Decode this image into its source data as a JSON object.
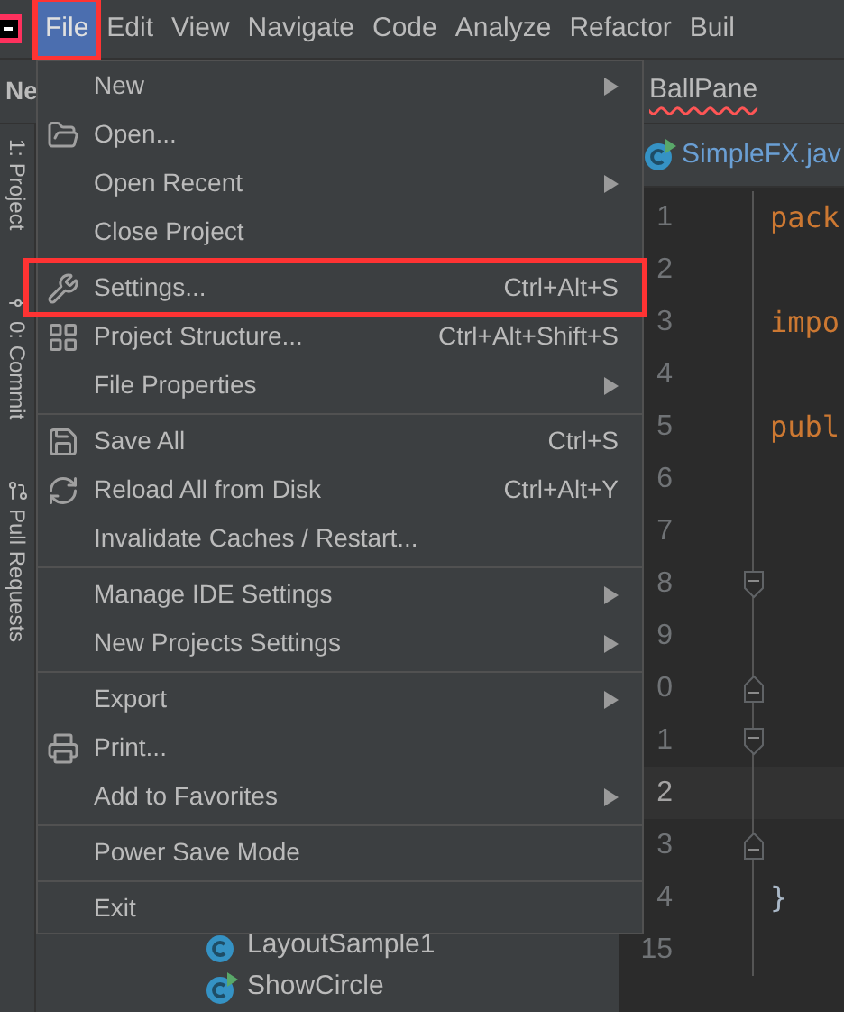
{
  "menubar": [
    {
      "label": "File",
      "selected": true,
      "highlighted": true
    },
    {
      "label": "Edit",
      "selected": false,
      "highlighted": false
    },
    {
      "label": "View",
      "selected": false,
      "highlighted": false
    },
    {
      "label": "Navigate",
      "selected": false,
      "highlighted": false
    },
    {
      "label": "Code",
      "selected": false,
      "highlighted": false
    },
    {
      "label": "Analyze",
      "selected": false,
      "highlighted": false
    },
    {
      "label": "Refactor",
      "selected": false,
      "highlighted": false
    },
    {
      "label": "Buil",
      "selected": false,
      "highlighted": false
    }
  ],
  "file_menu": [
    {
      "kind": "item",
      "label": "New",
      "submenu": true,
      "highlighted": false
    },
    {
      "kind": "item",
      "label": "Open...",
      "submenu": false,
      "highlighted": false
    },
    {
      "kind": "item",
      "label": "Open Recent",
      "submenu": true,
      "highlighted": false
    },
    {
      "kind": "item",
      "label": "Close Project",
      "submenu": false,
      "highlighted": false
    },
    {
      "kind": "separator"
    },
    {
      "kind": "item",
      "label": "Settings...",
      "shortcut": "Ctrl+Alt+S",
      "submenu": false,
      "highlighted": true
    },
    {
      "kind": "item",
      "label": "Project Structure...",
      "shortcut": "Ctrl+Alt+Shift+S",
      "submenu": false,
      "highlighted": false
    },
    {
      "kind": "item",
      "label": "File Properties",
      "submenu": true,
      "highlighted": false
    },
    {
      "kind": "separator"
    },
    {
      "kind": "item",
      "label": "Save All",
      "shortcut": "Ctrl+S",
      "submenu": false,
      "highlighted": false
    },
    {
      "kind": "item",
      "label": "Reload All from Disk",
      "shortcut": "Ctrl+Alt+Y",
      "submenu": false,
      "highlighted": false
    },
    {
      "kind": "item",
      "label": "Invalidate Caches / Restart...",
      "submenu": false,
      "highlighted": false
    },
    {
      "kind": "separator"
    },
    {
      "kind": "item",
      "label": "Manage IDE Settings",
      "submenu": true,
      "highlighted": false
    },
    {
      "kind": "item",
      "label": "New Projects Settings",
      "submenu": true,
      "highlighted": false
    },
    {
      "kind": "separator"
    },
    {
      "kind": "item",
      "label": "Export",
      "submenu": true,
      "highlighted": false
    },
    {
      "kind": "item",
      "label": "Print...",
      "submenu": false,
      "highlighted": false
    },
    {
      "kind": "item",
      "label": "Add to Favorites",
      "submenu": true,
      "highlighted": false
    },
    {
      "kind": "separator"
    },
    {
      "kind": "item",
      "label": "Power Save Mode",
      "submenu": false,
      "highlighted": false
    },
    {
      "kind": "separator"
    },
    {
      "kind": "item",
      "label": "Exit",
      "submenu": false,
      "highlighted": false
    }
  ],
  "project_panel": {
    "title": "Ne",
    "tool_windows": [
      {
        "label": "1: Project"
      },
      {
        "label": "0: Commit"
      },
      {
        "label": "Pull Requests"
      }
    ],
    "tree": [
      {
        "label": "LayoutSample1",
        "runnable": false
      },
      {
        "label": "ShowCircle",
        "runnable": true
      }
    ]
  },
  "editor": {
    "tabs": [
      {
        "label": "BallPane",
        "error": true
      },
      {
        "label": "SimpleFX.jav",
        "error": false,
        "runnable": true
      }
    ],
    "lines": [
      {
        "number": "1",
        "code": "pack",
        "current": false,
        "fold_start": false,
        "fold_end": false
      },
      {
        "number": "2",
        "current": false,
        "fold_start": false,
        "fold_end": false
      },
      {
        "number": "3",
        "code": "impo",
        "current": false,
        "fold_start": false,
        "fold_end": false
      },
      {
        "number": "4",
        "current": false,
        "fold_start": false,
        "fold_end": false
      },
      {
        "number": "5",
        "code": "publ",
        "current": false,
        "fold_start": false,
        "fold_end": false
      },
      {
        "number": "6",
        "current": false,
        "fold_start": false,
        "fold_end": false
      },
      {
        "number": "7",
        "current": false,
        "fold_start": false,
        "fold_end": false
      },
      {
        "number": "8",
        "current": false,
        "fold_start": true,
        "fold_end": false
      },
      {
        "number": "9",
        "current": false,
        "fold_start": false,
        "fold_end": false
      },
      {
        "number": "0",
        "current": false,
        "fold_start": false,
        "fold_end": true
      },
      {
        "number": "1",
        "current": false,
        "fold_start": true,
        "fold_end": false
      },
      {
        "number": "2",
        "current": true,
        "fold_start": false,
        "fold_end": false
      },
      {
        "number": "3",
        "current": false,
        "fold_start": false,
        "fold_end": true
      },
      {
        "number": "4",
        "code": "}",
        "current": false,
        "fold_start": false,
        "fold_end": false
      },
      {
        "number": "15",
        "current": false,
        "fold_start": false,
        "fold_end": false
      }
    ]
  }
}
